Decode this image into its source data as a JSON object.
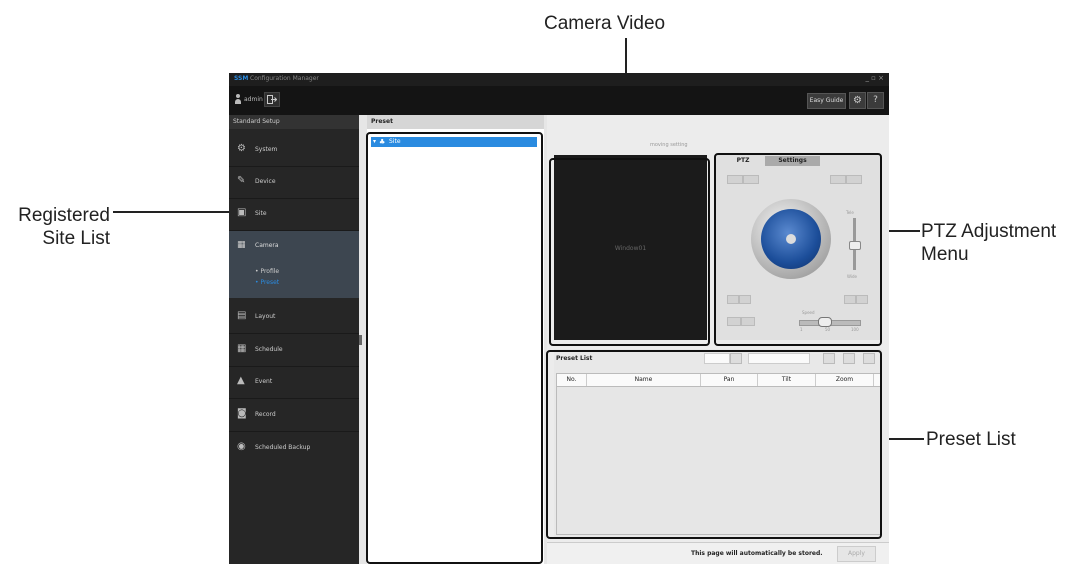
{
  "callouts": {
    "camera_video": "Camera Video",
    "registered_site_list_line1": "Registered",
    "registered_site_list_line2": "Site List",
    "ptz_adjustment_line1": "PTZ Adjustment",
    "ptz_adjustment_line2": "Menu",
    "preset_list": "Preset List"
  },
  "window": {
    "brand": "SSM",
    "title": "Configuration Manager",
    "window_controls": "_ ▫ ×"
  },
  "topbar": {
    "username": "admin",
    "easy_guide_label": "Easy Guide",
    "settings_icon": "⚙",
    "help_icon": "?"
  },
  "sidebar": {
    "header": "Standard Setup",
    "items": [
      {
        "label": "System",
        "icon": "⚙"
      },
      {
        "label": "Device",
        "icon": "✎"
      },
      {
        "label": "Site",
        "icon": "▣"
      },
      {
        "label": "Layout",
        "icon": "▤"
      },
      {
        "label": "Schedule",
        "icon": "▦"
      },
      {
        "label": "Event",
        "icon": "▲"
      },
      {
        "label": "Record",
        "icon": "◙"
      },
      {
        "label": "Scheduled Backup",
        "icon": "◉"
      }
    ],
    "camera": {
      "label": "Camera",
      "icon": "▦",
      "sub_items": [
        "Profile",
        "Preset"
      ],
      "active_sub": "Preset"
    }
  },
  "preset_panel": {
    "header": "Preset",
    "site_tree": [
      {
        "label": "Site",
        "expanded": true,
        "selected": true
      }
    ]
  },
  "main": {
    "moving_status": "moving setting",
    "video_label": "Window01",
    "ptz": {
      "tab_ptz": "PTZ",
      "tab_settings": "Settings",
      "zoom_tele": "Tele",
      "zoom_wide": "Wide",
      "speed_label": "Speed",
      "speed_min": "1",
      "speed_mid": "50",
      "speed_max": "100"
    },
    "preset_list": {
      "title": "Preset List",
      "columns": [
        "No.",
        "Name",
        "Pan",
        "Tilt",
        "Zoom"
      ],
      "rows": []
    },
    "autostore_text": "This page will automatically be stored.",
    "apply_label": "Apply"
  }
}
